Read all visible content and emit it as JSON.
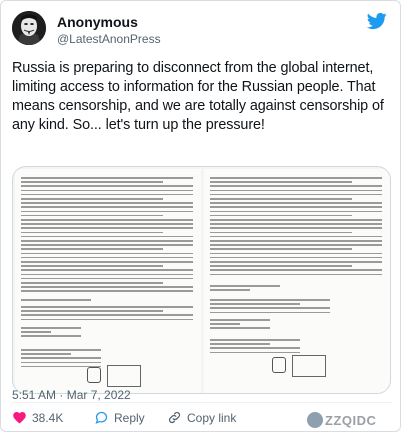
{
  "tweet": {
    "author_name": "Anonymous",
    "handle": "@LatestAnonPress",
    "text": "Russia is preparing to disconnect from the global internet, limiting access to information for the Russian people. That means censorship, and we are totally against censorship of any kind. So... let's turn up the pressure!",
    "timestamp": "5:51 AM · Mar 7, 2022",
    "likes": "38.4K",
    "reply_label": "Reply",
    "copy_link_label": "Copy link"
  },
  "icons": {
    "brand": "twitter-bird-icon",
    "avatar": "anonymous-mask-avatar",
    "like": "heart-icon",
    "reply": "reply-bubble-icon",
    "copy_link": "link-icon"
  },
  "watermark": {
    "text": "ZZQIDC"
  },
  "colors": {
    "twitter_blue": "#1d9bf0",
    "like_red": "#f91880",
    "secondary_text": "#536471"
  }
}
